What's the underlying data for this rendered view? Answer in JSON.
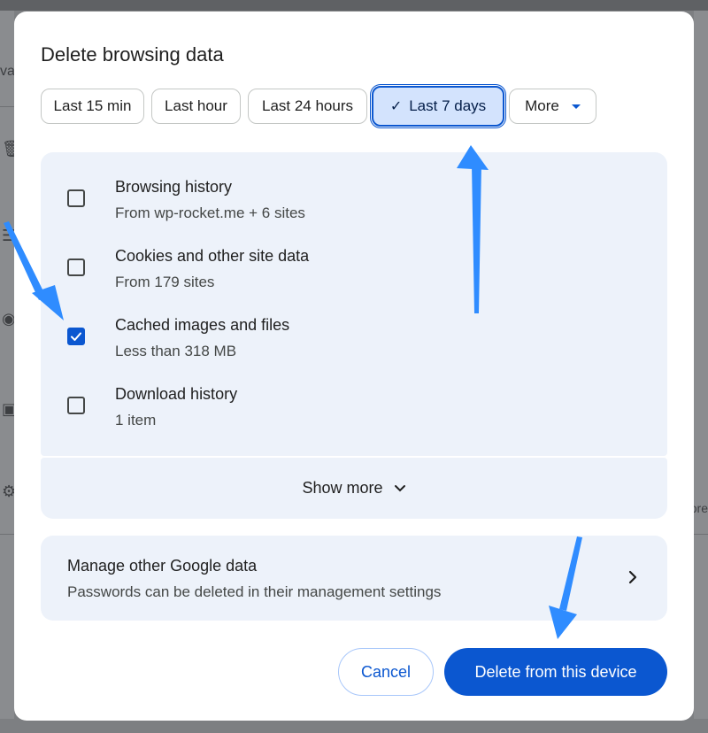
{
  "dialog": {
    "title": "Delete browsing data"
  },
  "time_range": {
    "options": [
      {
        "label": "Last 15 min",
        "selected": false
      },
      {
        "label": "Last hour",
        "selected": false
      },
      {
        "label": "Last 24 hours",
        "selected": false
      },
      {
        "label": "Last 7 days",
        "selected": true
      },
      {
        "label": "More",
        "selected": false
      }
    ]
  },
  "items": [
    {
      "title": "Browsing history",
      "subtitle": "From wp-rocket.me + 6 sites",
      "checked": false
    },
    {
      "title": "Cookies and other site data",
      "subtitle": "From 179 sites",
      "checked": false
    },
    {
      "title": "Cached images and files",
      "subtitle": "Less than 318 MB",
      "checked": true
    },
    {
      "title": "Download history",
      "subtitle": "1 item",
      "checked": false
    }
  ],
  "show_more": {
    "label": "Show more"
  },
  "manage": {
    "title": "Manage other Google data",
    "subtitle": "Passwords can be deleted in their management settings"
  },
  "actions": {
    "cancel_label": "Cancel",
    "delete_label": "Delete from this device"
  },
  "background": {
    "left_text": "va",
    "right_text": "ore"
  },
  "colors": {
    "accent": "#0b57d0",
    "selected_chip_bg": "#d3e3fd",
    "card_bg": "#edf2fa",
    "annotation_arrow": "#2f8cff"
  },
  "icons": {
    "check": "check-icon",
    "dropdown": "caret-down-icon",
    "expand": "chevron-down-icon",
    "navigate": "chevron-right-icon"
  }
}
